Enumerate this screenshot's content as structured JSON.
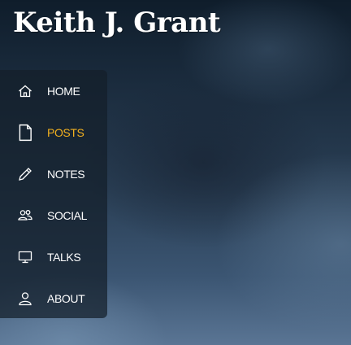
{
  "site": {
    "title": "Keith J. Grant"
  },
  "nav": {
    "items": [
      {
        "label": "HOME",
        "icon": "home-icon"
      },
      {
        "label": "POSTS",
        "icon": "document-icon"
      },
      {
        "label": "NOTES",
        "icon": "pencil-icon"
      },
      {
        "label": "SOCIAL",
        "icon": "people-icon"
      },
      {
        "label": "TALKS",
        "icon": "monitor-icon"
      },
      {
        "label": "ABOUT",
        "icon": "person-icon"
      }
    ],
    "active_index": 1
  },
  "colors": {
    "accent": "#f2b11f",
    "text": "#ffffff"
  }
}
